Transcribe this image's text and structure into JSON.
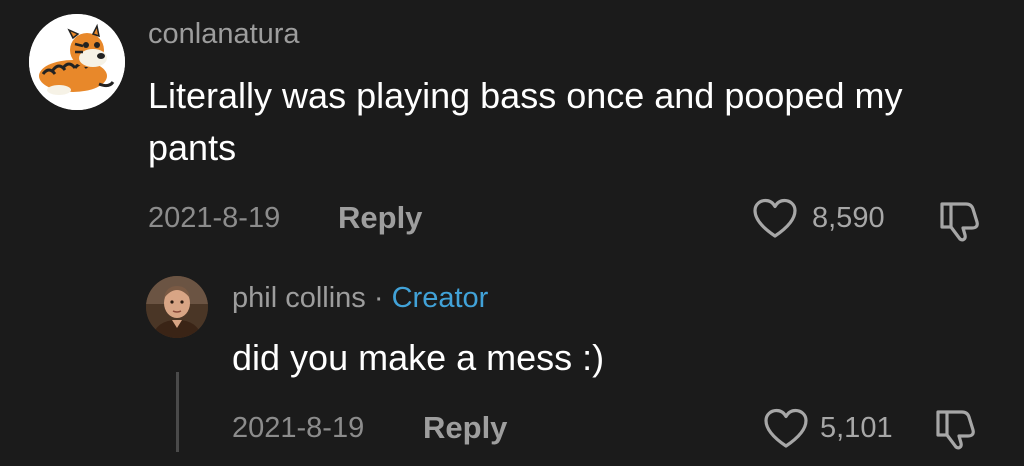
{
  "comment": {
    "username": "conlanatura",
    "text": "Literally was playing bass once and pooped my pants",
    "date": "2021-8-19",
    "reply_label": "Reply",
    "likes": "8,590",
    "avatar_icon": "cartoon-tiger-avatar"
  },
  "reply": {
    "username": "phil collins",
    "separator": "·",
    "badge": "Creator",
    "text": "did you make a mess :)",
    "date": "2021-8-19",
    "reply_label": "Reply",
    "likes": "5,101",
    "avatar_icon": "person-photo-avatar"
  },
  "colors": {
    "background": "#1b1b1b",
    "creator_badge": "#41a2d8",
    "muted_text": "#9d9d9d"
  }
}
